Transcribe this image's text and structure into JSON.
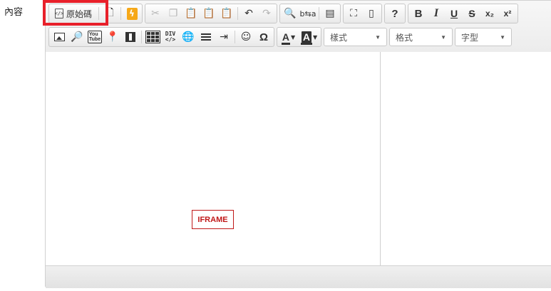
{
  "field": {
    "label": "內容"
  },
  "toolbar": {
    "source_label": "原始碼",
    "style_combo": "樣式",
    "format_combo": "格式",
    "font_combo": "字型"
  },
  "content": {
    "iframe_placeholder": "IFRAME"
  },
  "icons": {
    "highlight_color": "#e8202a",
    "iframe_color": "#c01818"
  }
}
